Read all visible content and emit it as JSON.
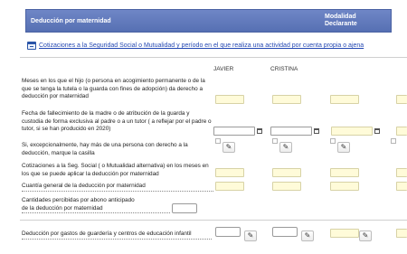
{
  "header": {
    "title": "Deducción por maternidad",
    "modalidad_line1": "Modalidad",
    "modalidad_line2": "Declarante"
  },
  "link": {
    "text": "Cotizaciones a la Seguridad Social o Mutualidad y período en el que realiza una actividad por cuenta propia o ajena"
  },
  "columns": [
    "JAVIER",
    "CRISTINA"
  ],
  "rows": {
    "meses": "Meses en los que el hijo (o persona en acogimiento permanente o de la que se tenga la tutela o la guarda con fines de adopción) da derecho a deducción por maternidad",
    "fallecimiento": "Fecha de fallecimiento de la madre o de atribución de la guarda y custodia de forma exclusiva al padre o a un tutor ( a reflejar por el padre o tutor, si se han producido en 2020)",
    "excepcional": "Si, excepcionalmente, hay más de una persona con derecho a la deducción, marque la casilla",
    "cotizaciones": "Cotizaciones a la Seg. Social ( o Mutualidad alternativa) en los meses en los que se puede aplicar la deducción por maternidad",
    "cuantia": "Cuantía general de la deducción por maternidad",
    "cantidades_line1": "Cantidades percibidas por abono anticipado",
    "cantidades_line2": "de la deducción por maternidad",
    "guarderia": "Deducción por gastos de guardería y centros de educación infantil"
  },
  "icons": {
    "calendar": "calendar-icon",
    "pencil": "pencil-icon"
  },
  "glyphs": {
    "pencil": "✎"
  },
  "colors": {
    "header": "#5a72b6",
    "link": "#2448b3",
    "input_fill": "#fffbd9"
  }
}
